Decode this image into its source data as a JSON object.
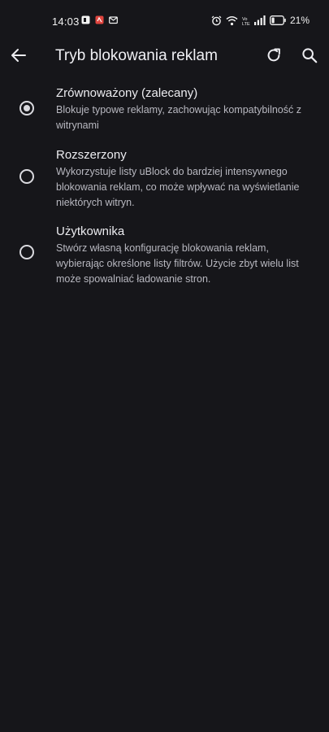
{
  "status_bar": {
    "time": "14:03",
    "battery_percent": "21%",
    "left_icons": [
      "notification-square-icon",
      "red-app-icon",
      "mail-icon"
    ],
    "right_icons": [
      "alarm-icon",
      "wifi-icon",
      "volte-icon",
      "signal-icon",
      "battery-icon"
    ]
  },
  "app_bar": {
    "title": "Tryb blokowania reklam",
    "icons": [
      "arrow-back-icon",
      "refresh-icon",
      "search-icon"
    ]
  },
  "options": [
    {
      "title": "Zrównoważony (zalecany)",
      "description": "Blokuje typowe reklamy, zachowując kompatybilność z witrynami",
      "selected": true
    },
    {
      "title": "Rozszerzony",
      "description": "Wykorzystuje listy uBlock do bardziej intensywnego blokowania reklam, co może wpływać na wyświetlanie niektórych witryn.",
      "selected": false
    },
    {
      "title": "Użytkownika",
      "description": "Stwórz własną konfigurację blokowania reklam, wybierając określone listy filtrów. Użycie zbyt wielu list może spowalniać ładowanie stron.",
      "selected": false
    }
  ]
}
